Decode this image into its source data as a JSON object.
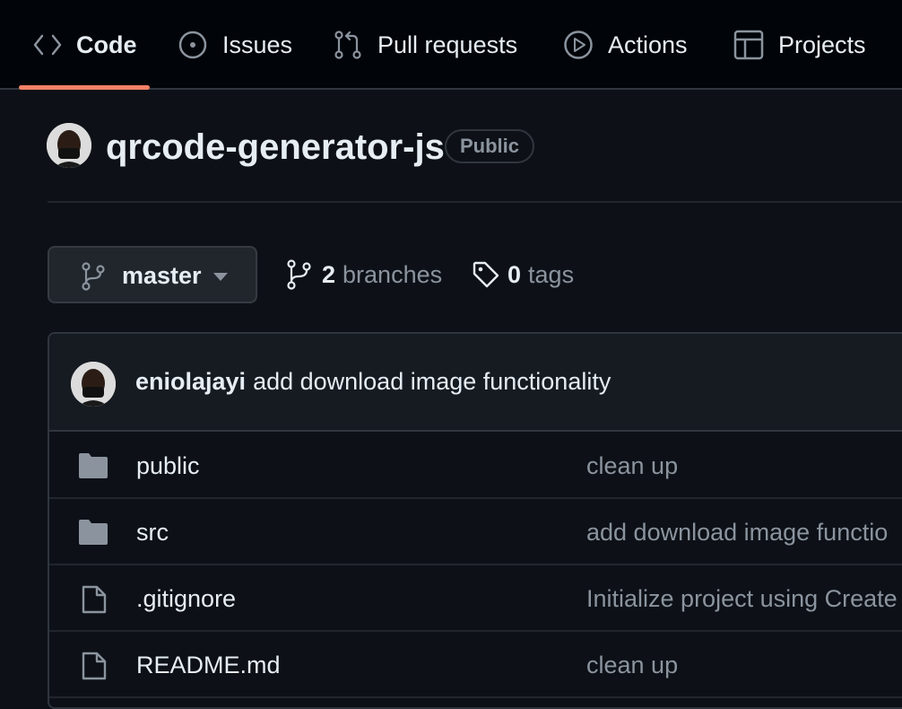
{
  "nav": {
    "tabs": [
      {
        "label": "Code",
        "icon": "code-icon",
        "selected": true
      },
      {
        "label": "Issues",
        "icon": "issue-opened-icon"
      },
      {
        "label": "Pull requests",
        "icon": "git-pull-request-icon"
      },
      {
        "label": "Actions",
        "icon": "play-icon"
      },
      {
        "label": "Projects",
        "icon": "table-icon"
      }
    ],
    "accent": "#f78166"
  },
  "repo": {
    "name": "qrcode-generator-js",
    "visibility": "Public"
  },
  "branch": {
    "current": "master",
    "branches_count": "2",
    "branches_label": "branches",
    "tags_count": "0",
    "tags_label": "tags"
  },
  "latest_commit": {
    "author": "eniolajayi",
    "message": "add download image functionality"
  },
  "files": [
    {
      "name": "public",
      "type": "folder",
      "message": "clean up"
    },
    {
      "name": "src",
      "type": "folder",
      "message": "add download image functio"
    },
    {
      "name": ".gitignore",
      "type": "file",
      "message": "Initialize project using Create"
    },
    {
      "name": "README.md",
      "type": "file",
      "message": "clean up"
    }
  ]
}
